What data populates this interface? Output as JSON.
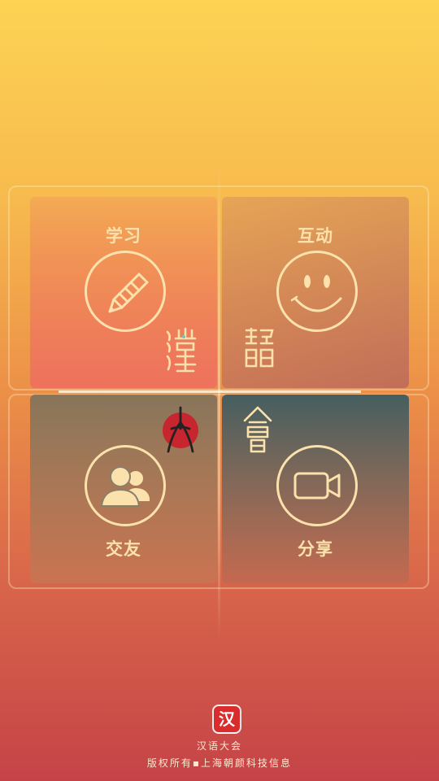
{
  "tiles": {
    "learn": {
      "label": "学习",
      "icon": "pencil-icon"
    },
    "interact": {
      "label": "互动",
      "icon": "smiley-icon"
    },
    "friends": {
      "label": "交友",
      "icon": "people-icon"
    },
    "share": {
      "label": "分享",
      "icon": "video-camera-icon"
    }
  },
  "footer": {
    "logo_text": "汉",
    "app_name": "汉语大会",
    "copyright": "版权所有▪上海朝颜科技信息"
  },
  "colors": {
    "accent": "#fbe2ad",
    "logo_red": "#d92d2d",
    "seal_red": "#c8262f"
  }
}
